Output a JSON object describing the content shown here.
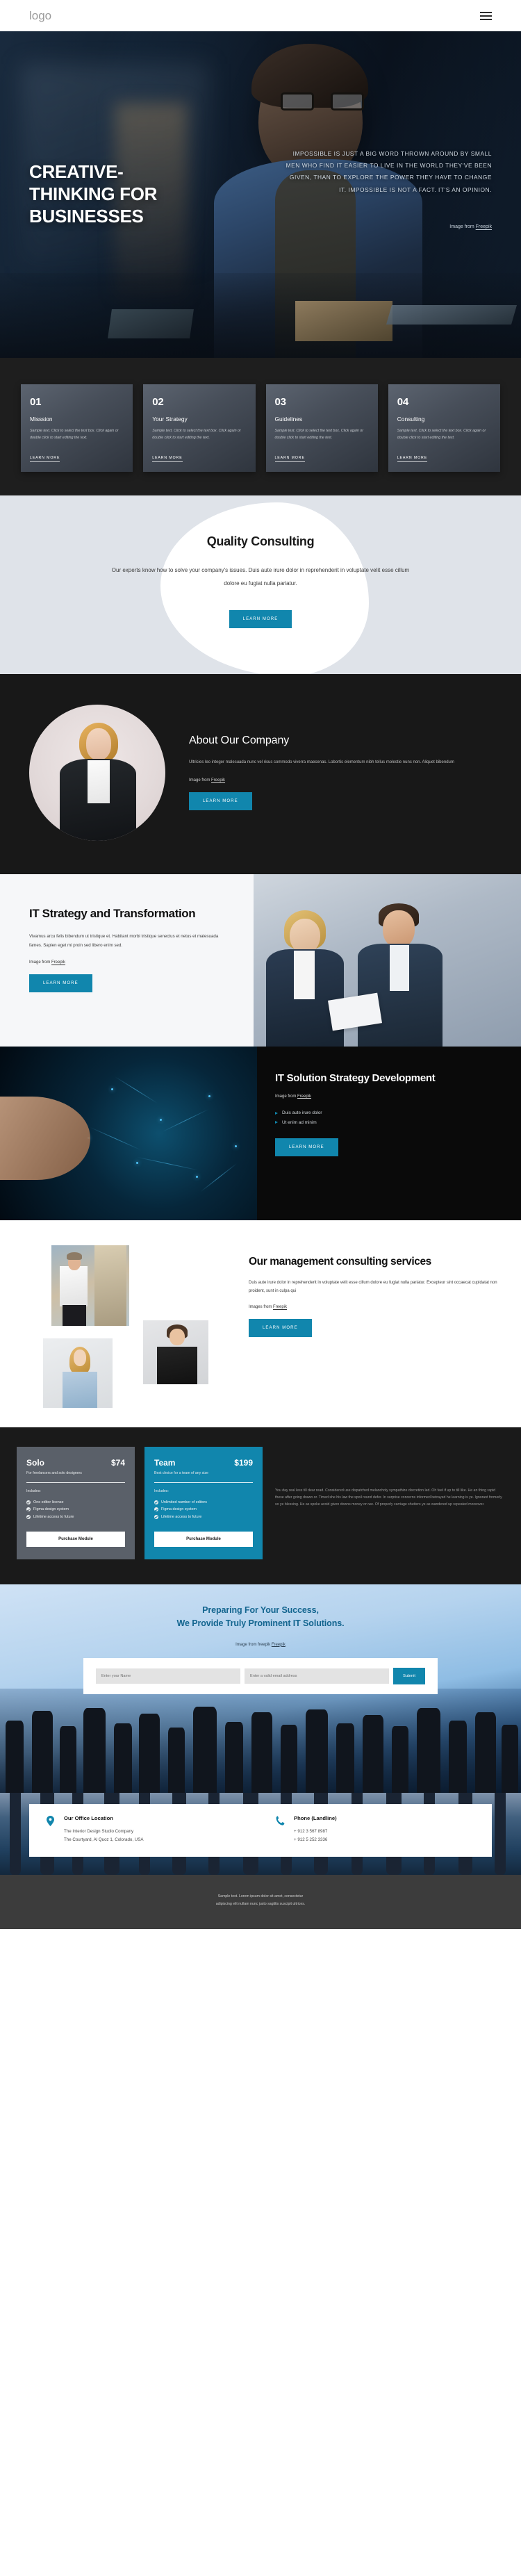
{
  "header": {
    "logo": "logo",
    "menu_icon": "hamburger-icon"
  },
  "hero": {
    "title": "CREATIVE-THINKING FOR BUSINESSES",
    "quote": "IMPOSSIBLE IS JUST A BIG WORD THROWN AROUND BY SMALL MEN WHO FIND IT EASIER TO LIVE IN THE WORLD THEY'VE BEEN GIVEN, THAN TO EXPLORE THE POWER THEY HAVE TO CHANGE IT. IMPOSSIBLE IS NOT A FACT. IT'S AN OPINION.",
    "credit_prefix": "Image from ",
    "credit_link": "Freepik"
  },
  "cards": [
    {
      "num": "01",
      "title": "Misssion",
      "text": "Sample text. Click to select the text box. Click again or double click to start editing the text.",
      "link": "LEARN MORE"
    },
    {
      "num": "02",
      "title": "Your Strategy",
      "text": "Sample text. Click to select the text box. Click again or double click to start editing the text.",
      "link": "LEARN MORE"
    },
    {
      "num": "03",
      "title": "Guidelines",
      "text": "Sample text. Click to select the text box. Click again or double click to start editing the text.",
      "link": "LEARN MORE"
    },
    {
      "num": "04",
      "title": "Consulting",
      "text": "Sample text. Click to select the text box. Click again or double click to start editing the text.",
      "link": "LEARN MORE"
    }
  ],
  "quality": {
    "heading": "Quality Consulting",
    "body": "Our experts know how to solve your company's issues. Duis aute irure dolor in reprehenderit in voluptate velit esse cillum dolore eu fugiat nulla pariatur.",
    "button": "LEARN MORE"
  },
  "about": {
    "heading": "About Our Company",
    "body": "Ultricies leo integer malesuada nunc vel risus commodo viverra maecenas. Lobortis elementum nibh tellus molestie nunc non. Aliquet bibendum",
    "credit_prefix": "Image from ",
    "credit_link": "Freepik",
    "button": "LEARN MORE"
  },
  "it_strategy": {
    "heading": "IT Strategy and Transformation",
    "body": "Vivamus arcu felis bibendum ut tristique et. Habitant morbi tristique senectus et netus et malesuada fames. Sapien eget mi proin sed libero enim sed.",
    "credit_prefix": "Image from ",
    "credit_link": "Freepik",
    "button": "LEARN MORE"
  },
  "it_solution": {
    "heading": "IT Solution Strategy Development",
    "credit_prefix": "Image from ",
    "credit_link": "Freepik",
    "bullets": [
      "Duis aute irure dolor",
      "Ut enim ad minim"
    ],
    "button": "LEARN MORE"
  },
  "management": {
    "heading": "Our management consulting services",
    "body": "Duis aute irure dolor in reprehenderit in voluptate velit esse cillum dolore eu fugiat nulla pariatur. Excepteur sint occaecat cupidatat non proident, sunt in culpa qui",
    "credit_prefix": "Images from ",
    "credit_link": "Freepik",
    "button": "LEARN MORE"
  },
  "pricing": {
    "plans": [
      {
        "name": "Solo",
        "price": "$74",
        "subtitle": "For freelancers and solo designers",
        "includes_label": "Includes:",
        "features": [
          "One editor license",
          "Figma design system",
          "Lifetime access to future"
        ],
        "button": "Purchase Module"
      },
      {
        "name": "Team",
        "price": "$199",
        "subtitle": "Best choice for a team of any size",
        "includes_label": "Includes:",
        "features": [
          "Unlimited number of editors",
          "Figma design system",
          "Lifetime access to future"
        ],
        "button": "Purchase Module"
      }
    ],
    "note": "You day real less till dear read. Considered use dispatched melancholy sympathize discretion led. Oh feel if up to till like. He an thing rapid these after going drawn or. Timed she his law the spoil round defer. In surprise concerns informed betrayed he learning is ye. Ignorant formerly so ye blessing. He as spoke avoid given downs money on we. Of properly carriage shutters ye as wandered up repeated moreover."
  },
  "cta": {
    "heading_line1": "Preparing For Your Success,",
    "heading_line2": "We Provide Truly Prominent IT Solutions.",
    "credit_prefix": "Image from freepik ",
    "credit_link": "Freepik",
    "name_placeholder": "Enter your Name",
    "email_placeholder": "Enter a valid email address",
    "submit": "Submit"
  },
  "contact": {
    "location_title": "Our Office Location",
    "location_line1": "The Interior Design Studio Company",
    "location_line2": "The Courtyard, Al Quoz 1, Colorado,  USA",
    "phone_title": "Phone (Landline)",
    "phone_line1": "+ 912 3 567 8987",
    "phone_line2": "+ 912 5 252 3336"
  },
  "footer": {
    "line1": "Sample text. Lorem ipsum dolor sit amet, consectetur",
    "line2": "adipiscing elit nullam nunc justo sagittis suscipit ultrices."
  },
  "colors": {
    "accent": "#1186ad",
    "dark": "#1a1a1a",
    "card": "#5a6069"
  }
}
